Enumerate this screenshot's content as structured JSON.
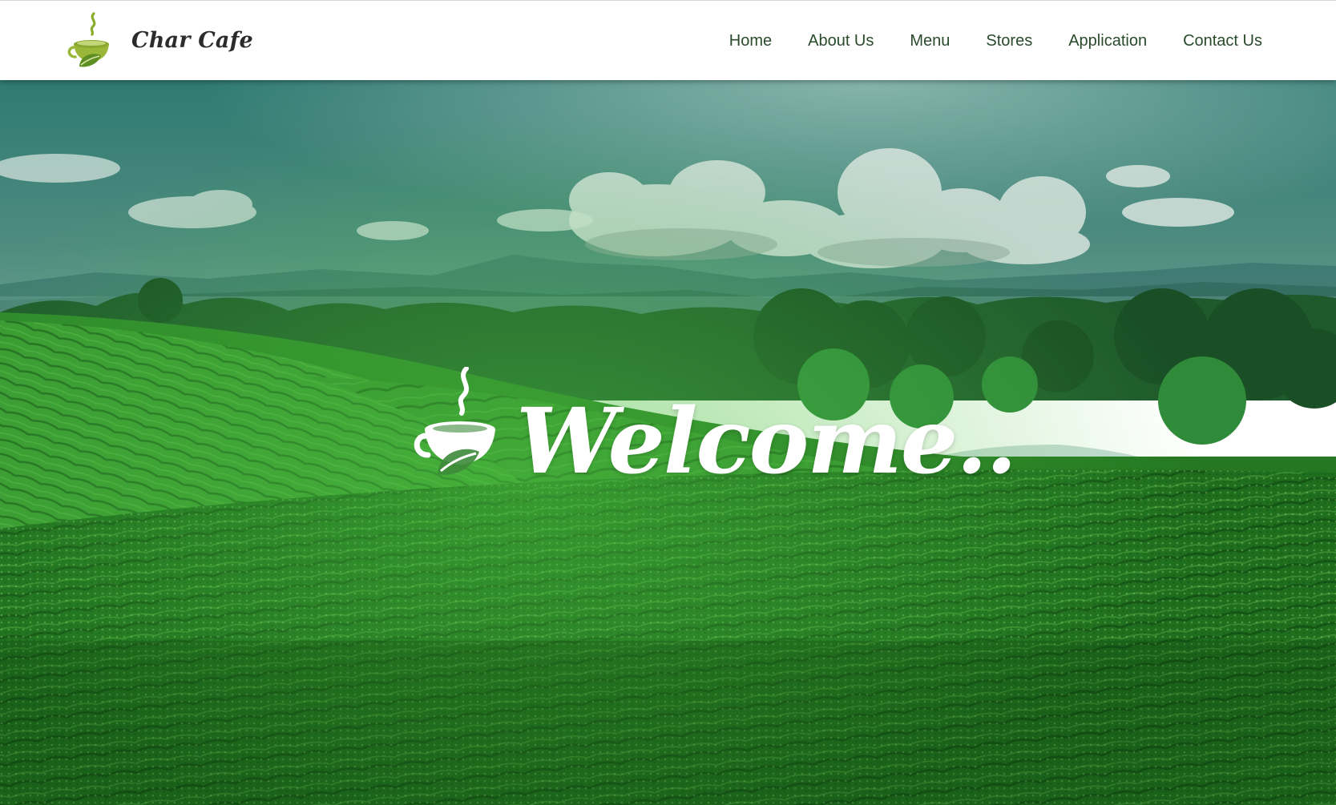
{
  "header": {
    "brand": {
      "name": "Char Cafe",
      "logo_icon": "tea-cup-leaf-icon",
      "logo_colors": {
        "steam": "#8bab2a",
        "cup": "#9ab73a",
        "leaf": "#5f8f22"
      }
    },
    "nav": [
      {
        "label": "Home"
      },
      {
        "label": "About Us"
      },
      {
        "label": "Menu"
      },
      {
        "label": "Stores"
      },
      {
        "label": "Application"
      },
      {
        "label": "Contact Us"
      }
    ],
    "nav_text_color": "#2a4a2c"
  },
  "hero": {
    "background": "tea-plantation-hills",
    "welcome_icon": "tea-cup-leaf-icon",
    "welcome_text": "Welcome..",
    "welcome_color": "#ffffff"
  }
}
